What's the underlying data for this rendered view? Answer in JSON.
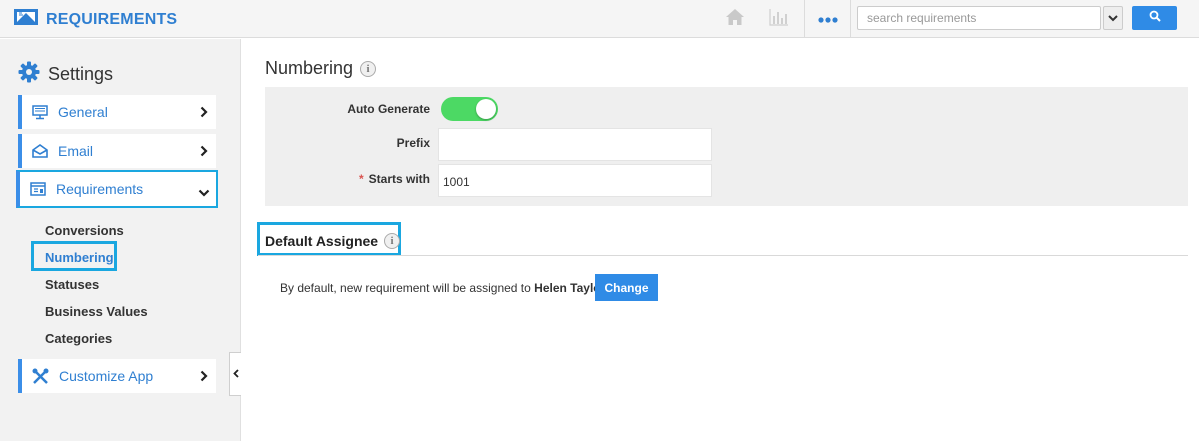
{
  "app": {
    "title": "REQUIREMENTS",
    "accent": "#2f7fd1",
    "icons": [
      "home-icon",
      "chart-icon",
      "more-dots-icon",
      "search-icon",
      "chevron-down-icon"
    ]
  },
  "search": {
    "placeholder": "search requirements",
    "value": ""
  },
  "sidebar": {
    "title": "Settings",
    "items": [
      {
        "label": "General",
        "icon": "monitor-icon"
      },
      {
        "label": "Email",
        "icon": "envelope-icon"
      },
      {
        "label": "Requirements",
        "icon": "requirements-icon",
        "expanded": true
      },
      {
        "label": "Customize App",
        "icon": "tools-icon"
      }
    ],
    "subitems": [
      "Conversions",
      "Numbering",
      "Statuses",
      "Business Values",
      "Categories"
    ],
    "current_subitem": "Numbering"
  },
  "numbering": {
    "title": "Numbering",
    "auto_generate_label": "Auto Generate",
    "auto_generate_on": true,
    "prefix_label": "Prefix",
    "prefix_value": "",
    "starts_with_label": "Starts with",
    "starts_with_required": "*",
    "starts_with_value": "1001"
  },
  "default_assignee": {
    "title": "Default Assignee",
    "text": "By default, new requirement will be assigned to",
    "assignee": "Helen Taylor",
    "change_label": "Change"
  }
}
